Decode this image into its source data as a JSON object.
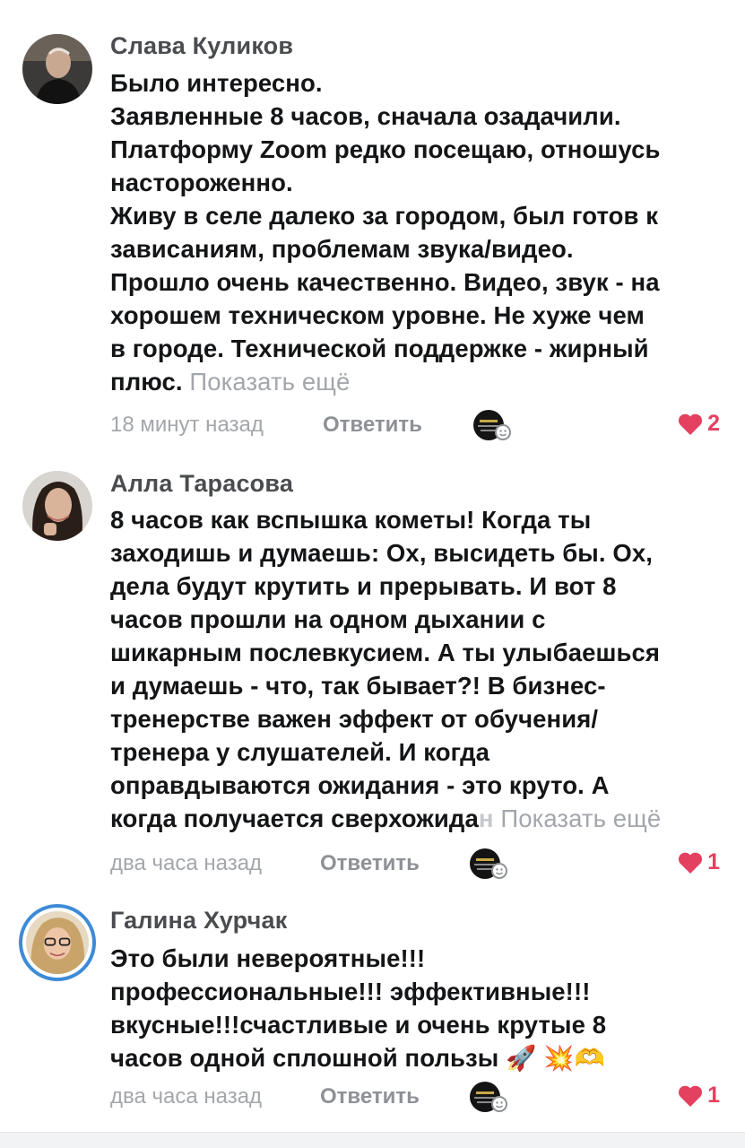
{
  "comments": [
    {
      "author": "Слава Куликов",
      "lines": [
        "Было интересно.",
        "Заявленные 8 часов, сначала озадачили.",
        "Платформу Zoom  редко посещаю, отношусь",
        "настороженно.",
        "Живу в селе далеко за городом, был готов к",
        "зависаниям, проблемам звука/видео.",
        "Прошло очень качественно. Видео, звук - на",
        "хорошем техническом уровне. Не хуже чем",
        "в городе. Технической поддержке - жирный"
      ],
      "last_line": "плюс.",
      "show_more": "Показать ещё",
      "time": "18 минут назад",
      "reply": "Ответить",
      "likes": "2"
    },
    {
      "author": "Алла Тарасова",
      "lines": [
        "8 часов как вспышка кометы! Когда ты",
        "заходишь и думаешь: Ох, высидеть бы. Ох,",
        "дела будут крутить и прерывать. И вот 8",
        "часов прошли на одном дыхании с",
        "шикарным послевкусием. А ты улыбаешься",
        "и думаешь - что, так бывает?! В бизнес-",
        "тренерстве важен эффект от обучения/",
        "тренера у слушателей. И когда",
        "оправдываются ожидания - это круто. А"
      ],
      "last_line": "когда получается сверхожида",
      "last_fade": "н",
      "show_more": "Показать ещё",
      "time": "два часа назад",
      "reply": "Ответить",
      "likes": "1"
    },
    {
      "author": "Галина Хурчак",
      "lines": [
        "Это были невероятные!!!",
        "профессиональные!!! эффективные!!!",
        "вкусные!!!счастливые и очень крутые 8"
      ],
      "last_line": "часов одной сплошной пользы",
      "emoji": "🚀  💥🫶",
      "time": "два часа назад",
      "reply": "Ответить",
      "likes": "1"
    }
  ],
  "colors": {
    "author": "#4a4c4f",
    "text": "#141517",
    "muted": "#a3a6ab",
    "like": "#e4405f",
    "story_ring": "#3d8bd6"
  },
  "icons": [
    "heart-icon",
    "emoji-reaction-icon"
  ]
}
